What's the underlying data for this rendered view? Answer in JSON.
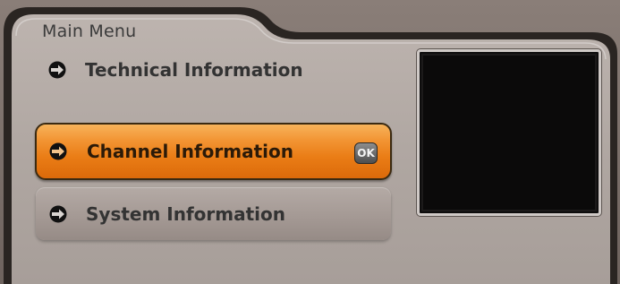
{
  "breadcrumb": "Main Menu",
  "menu": {
    "items": [
      {
        "label": "Technical Information",
        "icon": "arrow-right-icon",
        "state": "normal"
      },
      {
        "label": "Channel Information",
        "icon": "arrow-right-icon",
        "state": "selected"
      },
      {
        "label": "System Information",
        "icon": "arrow-right-icon",
        "state": "normal"
      }
    ],
    "ok_label": "OK"
  },
  "colors": {
    "panel": "#b0a7a2",
    "highlight": "#f08a24",
    "panel_dark_frame": "#2a2522",
    "preview": "#0b0a0a"
  }
}
